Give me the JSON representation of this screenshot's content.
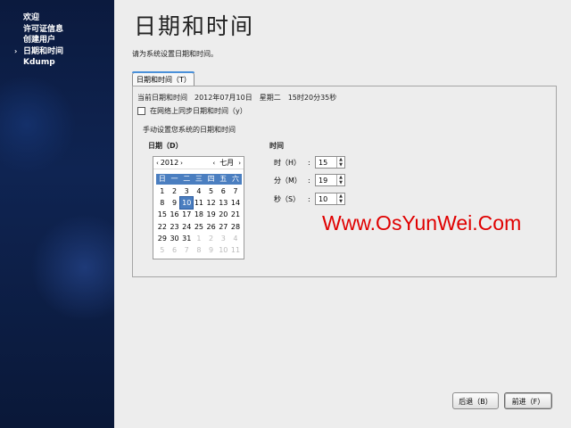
{
  "sidebar": {
    "items": [
      {
        "label": "欢迎"
      },
      {
        "label": "许可证信息"
      },
      {
        "label": "创建用户"
      },
      {
        "label": "日期和时间",
        "current": true
      },
      {
        "label": "Kdump"
      }
    ],
    "current_arrow": "›"
  },
  "page": {
    "title": "日期和时间",
    "subtitle": "请为系统设置日期和时间。"
  },
  "tab": {
    "label": "日期和时间（T）"
  },
  "panel": {
    "current_datetime": "当前日期和时间　2012年07月10日　星期二　15时20分35秒",
    "sync_label": "在网络上同步日期和时间（y）",
    "sync_checked": false,
    "manual_label": "手动设置您系统的日期和时间",
    "date_label": "日期（D）",
    "time_label": "时间"
  },
  "calendar": {
    "year": "2012",
    "month": "七月",
    "weekdays": [
      "日",
      "一",
      "二",
      "三",
      "四",
      "五",
      "六"
    ],
    "selected_day": "10",
    "weeks": [
      [
        {
          "d": "1"
        },
        {
          "d": "2"
        },
        {
          "d": "3"
        },
        {
          "d": "4"
        },
        {
          "d": "5"
        },
        {
          "d": "6"
        },
        {
          "d": "7"
        }
      ],
      [
        {
          "d": "8"
        },
        {
          "d": "9"
        },
        {
          "d": "10",
          "sel": true
        },
        {
          "d": "11"
        },
        {
          "d": "12"
        },
        {
          "d": "13"
        },
        {
          "d": "14"
        }
      ],
      [
        {
          "d": "15"
        },
        {
          "d": "16"
        },
        {
          "d": "17"
        },
        {
          "d": "18"
        },
        {
          "d": "19"
        },
        {
          "d": "20"
        },
        {
          "d": "21"
        }
      ],
      [
        {
          "d": "22"
        },
        {
          "d": "23"
        },
        {
          "d": "24"
        },
        {
          "d": "25"
        },
        {
          "d": "26"
        },
        {
          "d": "27"
        },
        {
          "d": "28"
        }
      ],
      [
        {
          "d": "29"
        },
        {
          "d": "30"
        },
        {
          "d": "31"
        },
        {
          "d": "1",
          "other": true
        },
        {
          "d": "2",
          "other": true
        },
        {
          "d": "3",
          "other": true
        },
        {
          "d": "4",
          "other": true
        }
      ],
      [
        {
          "d": "5",
          "other": true
        },
        {
          "d": "6",
          "other": true
        },
        {
          "d": "7",
          "other": true
        },
        {
          "d": "8",
          "other": true
        },
        {
          "d": "9",
          "other": true
        },
        {
          "d": "10",
          "other": true
        },
        {
          "d": "11",
          "other": true
        }
      ]
    ]
  },
  "time": {
    "hour_label": "时（H）",
    "hour_value": "15",
    "minute_label": "分（M）",
    "minute_value": "19",
    "second_label": "秒（S）",
    "second_value": "10",
    "colon": ":"
  },
  "watermark": "Www.OsYunWei.Com",
  "buttons": {
    "back": "后退（B）",
    "next": "前进（F）"
  },
  "colors": {
    "sidebar_bg": "#0f2452",
    "selection": "#4a7ec0",
    "watermark": "#e00000",
    "tab_accent": "#4a90d9"
  }
}
